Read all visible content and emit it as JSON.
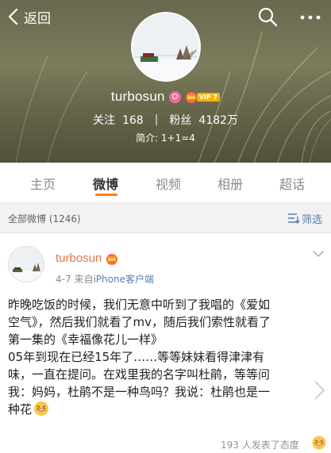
{
  "topbar": {
    "back_label": "返回"
  },
  "profile": {
    "username": "turbosun",
    "vip_label": "VIP 7",
    "following_label": "关注",
    "following_count": "168",
    "followers_label": "粉丝",
    "followers_count": "4182万",
    "bio": "简介: 1+1=4"
  },
  "tabs": [
    {
      "label": "主页"
    },
    {
      "label": "微博"
    },
    {
      "label": "视频"
    },
    {
      "label": "相册"
    },
    {
      "label": "超话"
    }
  ],
  "active_tab": "微博",
  "filterbar": {
    "count_label": "全部微博 (1246)",
    "filter_label": "筛选"
  },
  "post": {
    "author": "turbosun",
    "date": "4-7",
    "source_prefix": "来自",
    "source": "iPhone客户端",
    "lines": [
      "昨晚吃饭的时候，我们无意中听到了我唱的《爱如",
      "空气》，然后我们就看了mv，随后我们索性就看了",
      "第一集的《幸福像花儿一样》",
      "05年到现在已经15年了……等等妹妹看得津津有",
      "味，一直在提问。在戏里我的名字叫杜鹃，等等问",
      "我：妈妈，杜鹃不是一种鸟吗？我说：杜鹃也是一",
      "种花"
    ],
    "reactions": "193 人发表了态度"
  },
  "colors": {
    "accent": "#ff8200",
    "link": "#5b7db1",
    "author": "#eb7350"
  }
}
